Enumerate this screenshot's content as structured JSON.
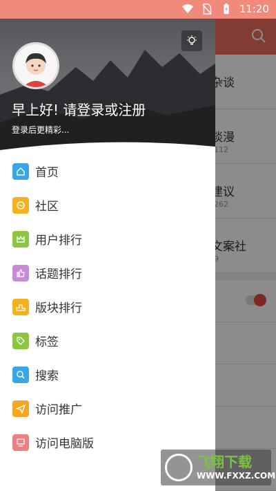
{
  "status_bar": {
    "time": "11:20"
  },
  "background": {
    "items": [
      {
        "title": "杂谈",
        "sub": ""
      },
      {
        "title": "谈漫",
        "sub": "112"
      },
      {
        "title": "建议",
        "sub": "262"
      },
      {
        "title": "文案社",
        "sub": "9"
      }
    ]
  },
  "drawer": {
    "greeting": "早上好! 请登录或注册",
    "subtext": "登录后更精彩...",
    "menu": [
      {
        "label": "首页",
        "color": "#3aa6e8"
      },
      {
        "label": "社区",
        "color": "#f5b21e"
      },
      {
        "label": "用户排行",
        "color": "#8cc63f"
      },
      {
        "label": "话题排行",
        "color": "#c58bd6"
      },
      {
        "label": "版块排行",
        "color": "#f5b21e"
      },
      {
        "label": "标签",
        "color": "#8cc63f"
      },
      {
        "label": "搜索",
        "color": "#3aa6e8"
      },
      {
        "label": "访问推广",
        "color": "#f5a623"
      },
      {
        "label": "访问电脑版",
        "color": "#f08080"
      }
    ]
  },
  "watermark": {
    "brand": "飞翔下载",
    "url": "WWW.FXXZ.COM"
  },
  "colors": {
    "status_bar": "#f08a7a",
    "app_bar": "#ee6e5f"
  }
}
